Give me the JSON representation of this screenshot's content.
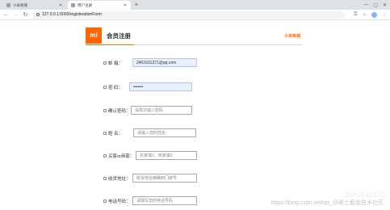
{
  "browser": {
    "tabs": [
      {
        "title": "小米商城",
        "active": false
      },
      {
        "title": "用户注册",
        "active": true
      }
    ],
    "new_tab_symbol": "+",
    "address": "127.0.0.1:5000/registerationForm",
    "win_min": "—",
    "win_max": "▢",
    "win_close": "✕"
  },
  "header": {
    "logo_text": "mi",
    "title": "会员注册",
    "brand_link": "小米商城",
    "accent_color": "#ff6700"
  },
  "form": {
    "email": {
      "label": "邮  箱：",
      "value": "2461631371@qq.com",
      "placeholder": ""
    },
    "password": {
      "label": "密  码：",
      "value": "•••••••",
      "placeholder": ""
    },
    "confirm": {
      "label": "确认密码：",
      "value": "",
      "placeholder": "请再次输入密码"
    },
    "name": {
      "label": "姓  名：",
      "value": "",
      "placeholder": "请输入您的姓名"
    },
    "role": {
      "label": "买家or商家：",
      "value": "",
      "placeholder": "买家填1，商家填2"
    },
    "address": {
      "label": "收货地址：",
      "value": "",
      "placeholder": "收货地址精确到门牌号"
    },
    "phone": {
      "label": "电话号码：",
      "value": "",
      "placeholder": "请填写您的电话号码"
    }
  },
  "watermark": {
    "text": "https://blog.csdn.net/qq_@稀土掘金技术社区",
    "faint": "2461631370"
  }
}
